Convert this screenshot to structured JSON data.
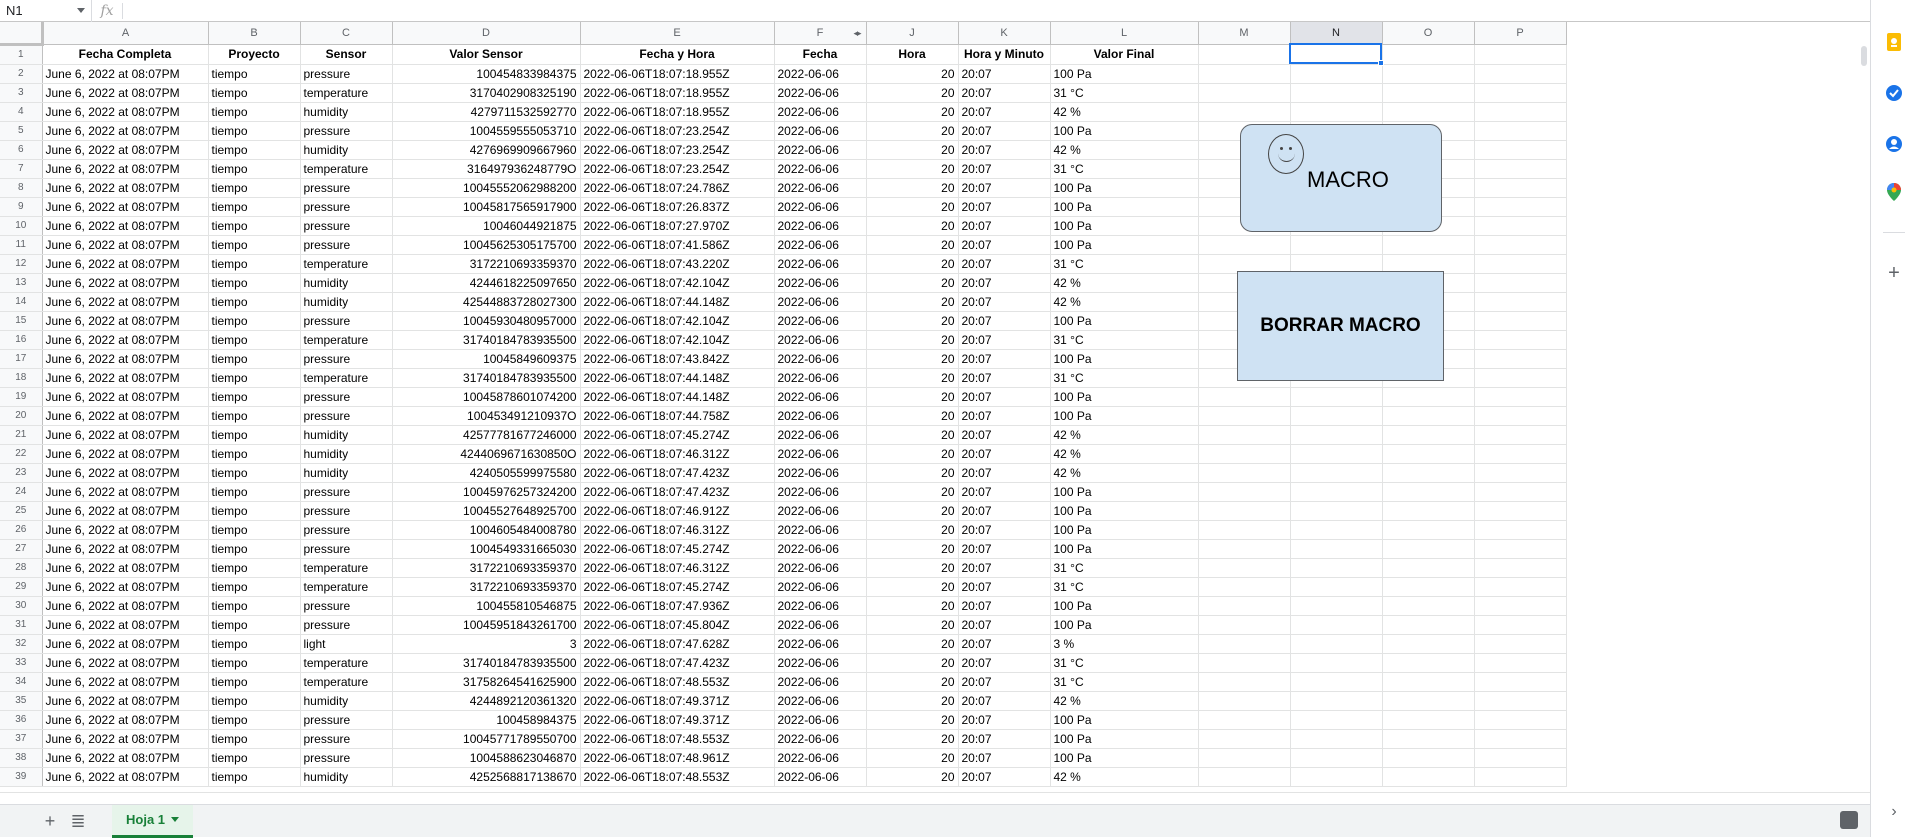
{
  "name_box": "N1",
  "fx_label": "fx",
  "columns": [
    "A",
    "B",
    "C",
    "D",
    "E",
    "F",
    "J",
    "K",
    "L",
    "M",
    "N",
    "O",
    "P"
  ],
  "selected_column": "N",
  "header_row": [
    "Fecha Completa",
    "Proyecto",
    "Sensor",
    "Valor Sensor",
    "Fecha y Hora",
    "Fecha",
    "Hora",
    "Hora y Minuto",
    "Valor Final",
    "",
    "",
    "",
    ""
  ],
  "rows": [
    [
      "June 6, 2022 at 08:07PM",
      "tiempo",
      "pressure",
      "100454833984375",
      "2022-06-06T18:07:18.955Z",
      "2022-06-06",
      "20",
      "20:07",
      "100 Pa"
    ],
    [
      "June 6, 2022 at 08:07PM",
      "tiempo",
      "temperature",
      "3170402908325190",
      "2022-06-06T18:07:18.955Z",
      "2022-06-06",
      "20",
      "20:07",
      "31 °C"
    ],
    [
      "June 6, 2022 at 08:07PM",
      "tiempo",
      "humidity",
      "4279711532592770",
      "2022-06-06T18:07:18.955Z",
      "2022-06-06",
      "20",
      "20:07",
      "42 %"
    ],
    [
      "June 6, 2022 at 08:07PM",
      "tiempo",
      "pressure",
      "1004559555053710",
      "2022-06-06T18:07:23.254Z",
      "2022-06-06",
      "20",
      "20:07",
      "100 Pa"
    ],
    [
      "June 6, 2022 at 08:07PM",
      "tiempo",
      "humidity",
      "4276969909667960",
      "2022-06-06T18:07:23.254Z",
      "2022-06-06",
      "20",
      "20:07",
      "42 %"
    ],
    [
      "June 6, 2022 at 08:07PM",
      "tiempo",
      "temperature",
      "316497936248779O",
      "2022-06-06T18:07:23.254Z",
      "2022-06-06",
      "20",
      "20:07",
      "31 °C"
    ],
    [
      "June 6, 2022 at 08:07PM",
      "tiempo",
      "pressure",
      "10045552062988200",
      "2022-06-06T18:07:24.786Z",
      "2022-06-06",
      "20",
      "20:07",
      "100 Pa"
    ],
    [
      "June 6, 2022 at 08:07PM",
      "tiempo",
      "pressure",
      "10045817565917900",
      "2022-06-06T18:07:26.837Z",
      "2022-06-06",
      "20",
      "20:07",
      "100 Pa"
    ],
    [
      "June 6, 2022 at 08:07PM",
      "tiempo",
      "pressure",
      "10046044921875",
      "2022-06-06T18:07:27.970Z",
      "2022-06-06",
      "20",
      "20:07",
      "100 Pa"
    ],
    [
      "June 6, 2022 at 08:07PM",
      "tiempo",
      "pressure",
      "10045625305175700",
      "2022-06-06T18:07:41.586Z",
      "2022-06-06",
      "20",
      "20:07",
      "100 Pa"
    ],
    [
      "June 6, 2022 at 08:07PM",
      "tiempo",
      "temperature",
      "3172210693359370",
      "2022-06-06T18:07:43.220Z",
      "2022-06-06",
      "20",
      "20:07",
      "31 °C"
    ],
    [
      "June 6, 2022 at 08:07PM",
      "tiempo",
      "humidity",
      "4244618225097650",
      "2022-06-06T18:07:42.104Z",
      "2022-06-06",
      "20",
      "20:07",
      "42 %"
    ],
    [
      "June 6, 2022 at 08:07PM",
      "tiempo",
      "humidity",
      "42544883728027300",
      "2022-06-06T18:07:44.148Z",
      "2022-06-06",
      "20",
      "20:07",
      "42 %"
    ],
    [
      "June 6, 2022 at 08:07PM",
      "tiempo",
      "pressure",
      "10045930480957000",
      "2022-06-06T18:07:42.104Z",
      "2022-06-06",
      "20",
      "20:07",
      "100 Pa"
    ],
    [
      "June 6, 2022 at 08:07PM",
      "tiempo",
      "temperature",
      "31740184783935500",
      "2022-06-06T18:07:42.104Z",
      "2022-06-06",
      "20",
      "20:07",
      "31 °C"
    ],
    [
      "June 6, 2022 at 08:07PM",
      "tiempo",
      "pressure",
      "10045849609375",
      "2022-06-06T18:07:43.842Z",
      "2022-06-06",
      "20",
      "20:07",
      "100 Pa"
    ],
    [
      "June 6, 2022 at 08:07PM",
      "tiempo",
      "temperature",
      "31740184783935500",
      "2022-06-06T18:07:44.148Z",
      "2022-06-06",
      "20",
      "20:07",
      "31 °C"
    ],
    [
      "June 6, 2022 at 08:07PM",
      "tiempo",
      "pressure",
      "10045878601074200",
      "2022-06-06T18:07:44.148Z",
      "2022-06-06",
      "20",
      "20:07",
      "100 Pa"
    ],
    [
      "June 6, 2022 at 08:07PM",
      "tiempo",
      "pressure",
      "100453491210937O",
      "2022-06-06T18:07:44.758Z",
      "2022-06-06",
      "20",
      "20:07",
      "100 Pa"
    ],
    [
      "June 6, 2022 at 08:07PM",
      "tiempo",
      "humidity",
      "42577781677246000",
      "2022-06-06T18:07:45.274Z",
      "2022-06-06",
      "20",
      "20:07",
      "42 %"
    ],
    [
      "June 6, 2022 at 08:07PM",
      "tiempo",
      "humidity",
      "4244069671630850O",
      "2022-06-06T18:07:46.312Z",
      "2022-06-06",
      "20",
      "20:07",
      "42 %"
    ],
    [
      "June 6, 2022 at 08:07PM",
      "tiempo",
      "humidity",
      "4240505599975580",
      "2022-06-06T18:07:47.423Z",
      "2022-06-06",
      "20",
      "20:07",
      "42 %"
    ],
    [
      "June 6, 2022 at 08:07PM",
      "tiempo",
      "pressure",
      "10045976257324200",
      "2022-06-06T18:07:47.423Z",
      "2022-06-06",
      "20",
      "20:07",
      "100 Pa"
    ],
    [
      "June 6, 2022 at 08:07PM",
      "tiempo",
      "pressure",
      "10045527648925700",
      "2022-06-06T18:07:46.912Z",
      "2022-06-06",
      "20",
      "20:07",
      "100 Pa"
    ],
    [
      "June 6, 2022 at 08:07PM",
      "tiempo",
      "pressure",
      "1004605484008780",
      "2022-06-06T18:07:46.312Z",
      "2022-06-06",
      "20",
      "20:07",
      "100 Pa"
    ],
    [
      "June 6, 2022 at 08:07PM",
      "tiempo",
      "pressure",
      "1004549331665030",
      "2022-06-06T18:07:45.274Z",
      "2022-06-06",
      "20",
      "20:07",
      "100 Pa"
    ],
    [
      "June 6, 2022 at 08:07PM",
      "tiempo",
      "temperature",
      "3172210693359370",
      "2022-06-06T18:07:46.312Z",
      "2022-06-06",
      "20",
      "20:07",
      "31 °C"
    ],
    [
      "June 6, 2022 at 08:07PM",
      "tiempo",
      "temperature",
      "3172210693359370",
      "2022-06-06T18:07:45.274Z",
      "2022-06-06",
      "20",
      "20:07",
      "31 °C"
    ],
    [
      "June 6, 2022 at 08:07PM",
      "tiempo",
      "pressure",
      "100455810546875",
      "2022-06-06T18:07:47.936Z",
      "2022-06-06",
      "20",
      "20:07",
      "100 Pa"
    ],
    [
      "June 6, 2022 at 08:07PM",
      "tiempo",
      "pressure",
      "10045951843261700",
      "2022-06-06T18:07:45.804Z",
      "2022-06-06",
      "20",
      "20:07",
      "100 Pa"
    ],
    [
      "June 6, 2022 at 08:07PM",
      "tiempo",
      "light",
      "3",
      "2022-06-06T18:07:47.628Z",
      "2022-06-06",
      "20",
      "20:07",
      "3 %"
    ],
    [
      "June 6, 2022 at 08:07PM",
      "tiempo",
      "temperature",
      "31740184783935500",
      "2022-06-06T18:07:47.423Z",
      "2022-06-06",
      "20",
      "20:07",
      "31 °C"
    ],
    [
      "June 6, 2022 at 08:07PM",
      "tiempo",
      "temperature",
      "31758264541625900",
      "2022-06-06T18:07:48.553Z",
      "2022-06-06",
      "20",
      "20:07",
      "31 °C"
    ],
    [
      "June 6, 2022 at 08:07PM",
      "tiempo",
      "humidity",
      "4244892120361320",
      "2022-06-06T18:07:49.371Z",
      "2022-06-06",
      "20",
      "20:07",
      "42 %"
    ],
    [
      "June 6, 2022 at 08:07PM",
      "tiempo",
      "pressure",
      "100458984375",
      "2022-06-06T18:07:49.371Z",
      "2022-06-06",
      "20",
      "20:07",
      "100 Pa"
    ],
    [
      "June 6, 2022 at 08:07PM",
      "tiempo",
      "pressure",
      "10045771789550700",
      "2022-06-06T18:07:48.553Z",
      "2022-06-06",
      "20",
      "20:07",
      "100 Pa"
    ],
    [
      "June 6, 2022 at 08:07PM",
      "tiempo",
      "pressure",
      "1004588623046870",
      "2022-06-06T18:07:48.961Z",
      "2022-06-06",
      "20",
      "20:07",
      "100 Pa"
    ],
    [
      "June 6, 2022 at 08:07PM",
      "tiempo",
      "humidity",
      "4252568817138670",
      "2022-06-06T18:07:48.553Z",
      "2022-06-06",
      "20",
      "20:07",
      "42 %"
    ]
  ],
  "buttons": {
    "macro": "MACRO",
    "borrar_macro": "BORRAR MACRO"
  },
  "sheet_tab": "Hoja 1",
  "side_icons": [
    "keep-icon",
    "tasks-icon",
    "contacts-icon",
    "maps-icon",
    "add-icon"
  ],
  "colors": {
    "selection": "#1a73e8",
    "button_fill": "#cfe2f3",
    "tab_green": "#188038"
  }
}
